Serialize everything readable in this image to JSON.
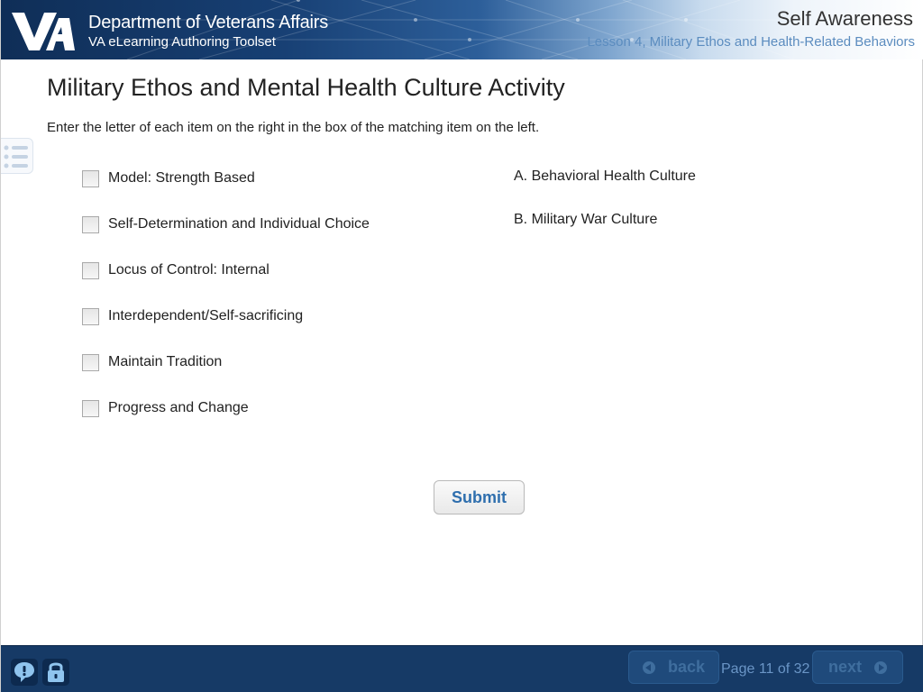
{
  "header": {
    "logo_text": "VA",
    "department": "Department of Veterans Affairs",
    "toolset": "VA eLearning Authoring Toolset",
    "course_title": "Self Awareness",
    "lesson_title": "Lesson 4, Military Ethos and Health-Related Behaviors"
  },
  "menu": {
    "icon": "list-icon"
  },
  "content": {
    "title": "Military Ethos and Mental Health Culture Activity",
    "instructions": "Enter the letter of each item on the right in the box of the matching item on the left.",
    "items": [
      {
        "label": "Model: Strength Based",
        "answer": ""
      },
      {
        "label": "Self-Determination and Individual Choice",
        "answer": ""
      },
      {
        "label": "Locus of Control: Internal",
        "answer": ""
      },
      {
        "label": "Interdependent/Self-sacrificing",
        "answer": ""
      },
      {
        "label": "Maintain Tradition",
        "answer": ""
      },
      {
        "label": "Progress and Change",
        "answer": ""
      }
    ],
    "choices": [
      {
        "label": "A. Behavioral Health Culture"
      },
      {
        "label": "B. Military War Culture"
      }
    ],
    "submit_label": "Submit"
  },
  "footer": {
    "help_icon": "help-icon",
    "lock_icon": "lock-icon",
    "back_label": "back",
    "page_counter": "Page 11 of 32",
    "next_label": "next"
  },
  "colors": {
    "header_dark": "#0f2e57",
    "footer": "#163a66",
    "accent": "#2f6fae",
    "lesson_text": "#5b8cbf"
  }
}
